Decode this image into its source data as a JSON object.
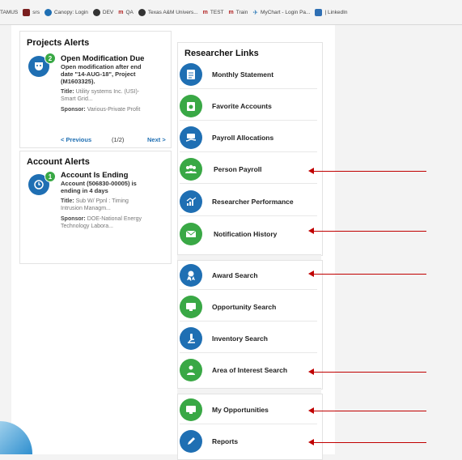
{
  "bookmarks": [
    {
      "label": "TAMUS",
      "color": "#f4f4f4"
    },
    {
      "label": "srs",
      "color": "#7a1f1f"
    },
    {
      "label": "Canopy: Login",
      "color": "#1f6fb3"
    },
    {
      "label": "DEV",
      "color": "#333333"
    },
    {
      "label": "QA",
      "color": "#b01e1e"
    },
    {
      "label": "Texas A&M Univers...",
      "color": "#333333"
    },
    {
      "label": "TEST",
      "color": "#b01e1e"
    },
    {
      "label": "Train",
      "color": "#b01e1e"
    },
    {
      "label": "MyChart - Login Pa...",
      "color": "#2f7bb8"
    },
    {
      "label": "| LinkedIn",
      "color": "#2f6fb3"
    }
  ],
  "projects_alerts": {
    "title": "Projects Alerts",
    "badge": "2",
    "heading": "Open Modification Due",
    "desc": [
      "Open modification after end",
      "date \"14-AUG-18\", Project",
      "(M1603325)."
    ],
    "title_label": "Title:",
    "title_value": "Utility systems Inc. (USI)-",
    "title_value2": "Smart Grid...",
    "sponsor_label": "Sponsor:",
    "sponsor_value": "Various-Private Profit",
    "prev": "< Previous",
    "page": "(1/2)",
    "next": "Next >"
  },
  "account_alerts": {
    "title": "Account Alerts",
    "badge": "1",
    "heading": "Account Is Ending",
    "desc": [
      "Account (506830-00005) is",
      "ending in 4 days"
    ],
    "title_label": "Title:",
    "title_value": "Sub W/ Ppnl : Timing",
    "title_value2": "Intrusion Managm...",
    "sponsor_label": "Sponsor:",
    "sponsor_value": "DOE-National Energy",
    "sponsor_value2": "Technology Labora..."
  },
  "researcher_links": {
    "title": "Researcher Links",
    "items": [
      {
        "label": "Monthly Statement",
        "color": "#1f6fb3"
      },
      {
        "label": "Favorite Accounts",
        "color": "#39a845"
      },
      {
        "label": "Payroll Allocations",
        "color": "#1f6fb3"
      },
      {
        "label": "Person Payroll",
        "color": "#39a845"
      },
      {
        "label": "Researcher Performance",
        "color": "#1f6fb3"
      },
      {
        "label": "Notification History",
        "color": "#39a845"
      },
      {
        "label": "Award Search",
        "color": "#1f6fb3"
      },
      {
        "label": "Opportunity Search",
        "color": "#39a845"
      },
      {
        "label": "Inventory Search",
        "color": "#1f6fb3"
      },
      {
        "label": "Area of Interest Search",
        "color": "#39a845"
      },
      {
        "label": "My Opportunities",
        "color": "#39a845"
      },
      {
        "label": "Reports",
        "color": "#1f6fb3"
      }
    ]
  },
  "colors": {
    "accent": "#1f6fb3",
    "green": "#39a845",
    "arrow": "#c00000"
  }
}
